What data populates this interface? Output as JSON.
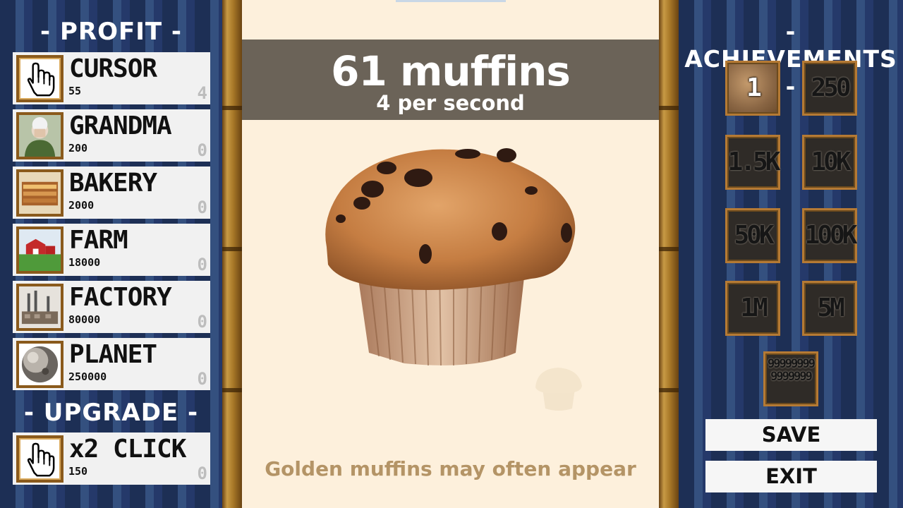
{
  "header": {
    "muffin_count": "61 muffins",
    "per_second": "4 per second"
  },
  "hint": "Golden muffins may often appear",
  "profit": {
    "title": "- PROFIT -",
    "items": [
      {
        "name": "CURSOR",
        "price": "55",
        "count": "4",
        "icon": "hand-cursor-icon"
      },
      {
        "name": "GRANDMA",
        "price": "200",
        "count": "0",
        "icon": "grandma-icon"
      },
      {
        "name": "BAKERY",
        "price": "2000",
        "count": "0",
        "icon": "bakery-icon"
      },
      {
        "name": "FARM",
        "price": "18000",
        "count": "0",
        "icon": "farm-icon"
      },
      {
        "name": "FACTORY",
        "price": "80000",
        "count": "0",
        "icon": "factory-icon"
      },
      {
        "name": "PLANET",
        "price": "250000",
        "count": "0",
        "icon": "planet-icon"
      }
    ]
  },
  "upgrade": {
    "title": "- UPGRADE -",
    "items": [
      {
        "name": "x2 CLICK",
        "price": "150",
        "count": "0",
        "icon": "hand-cursor-icon"
      }
    ]
  },
  "achievements": {
    "title": "- ACHIEVEMENTS -",
    "items": [
      {
        "label": "1",
        "unlocked": true
      },
      {
        "label": "250",
        "unlocked": false
      },
      {
        "label": "1.5K",
        "unlocked": false
      },
      {
        "label": "10K",
        "unlocked": false
      },
      {
        "label": "50K",
        "unlocked": false
      },
      {
        "label": "100K",
        "unlocked": false
      },
      {
        "label": "1M",
        "unlocked": false
      },
      {
        "label": "5M",
        "unlocked": false
      },
      {
        "label": "999999999999999",
        "unlocked": false
      }
    ]
  },
  "buttons": {
    "save": "SAVE",
    "exit": "EXIT"
  },
  "colors": {
    "score_band": "#6b6358",
    "center_bg": "#fdf0dc",
    "hint_text": "#b49466",
    "frame_gold": "#b57a34"
  }
}
